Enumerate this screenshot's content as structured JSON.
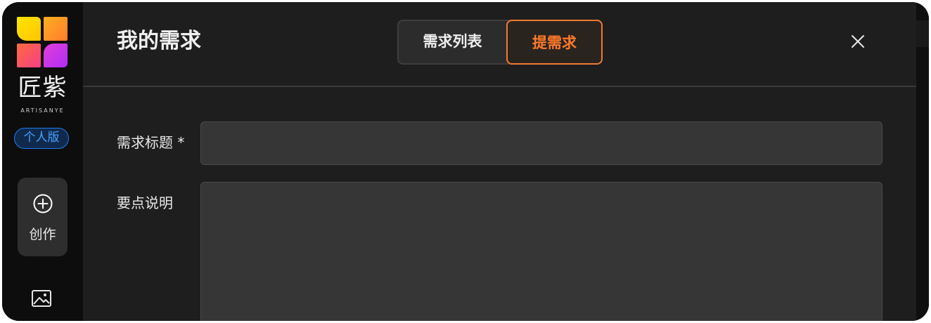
{
  "sidebar": {
    "brand_name": "匠紫",
    "brand_sub": "ARTISANYE",
    "edition_badge": "个人版",
    "create_label": "创作",
    "icons": [
      "logo-icon",
      "plus-circle-icon",
      "image-icon"
    ]
  },
  "header": {
    "title": "我的需求",
    "tabs": [
      {
        "label": "需求列表",
        "active": false
      },
      {
        "label": "提需求",
        "active": true
      }
    ],
    "close_icon": "close-icon"
  },
  "form": {
    "title_label": "需求标题 *",
    "title_value": "",
    "points_label": "要点说明",
    "points_value": ""
  },
  "colors": {
    "accent": "#f07a34",
    "badge": "#1e7ff0",
    "background": "#1e1e1e",
    "sidebar": "#0d0d0e"
  }
}
